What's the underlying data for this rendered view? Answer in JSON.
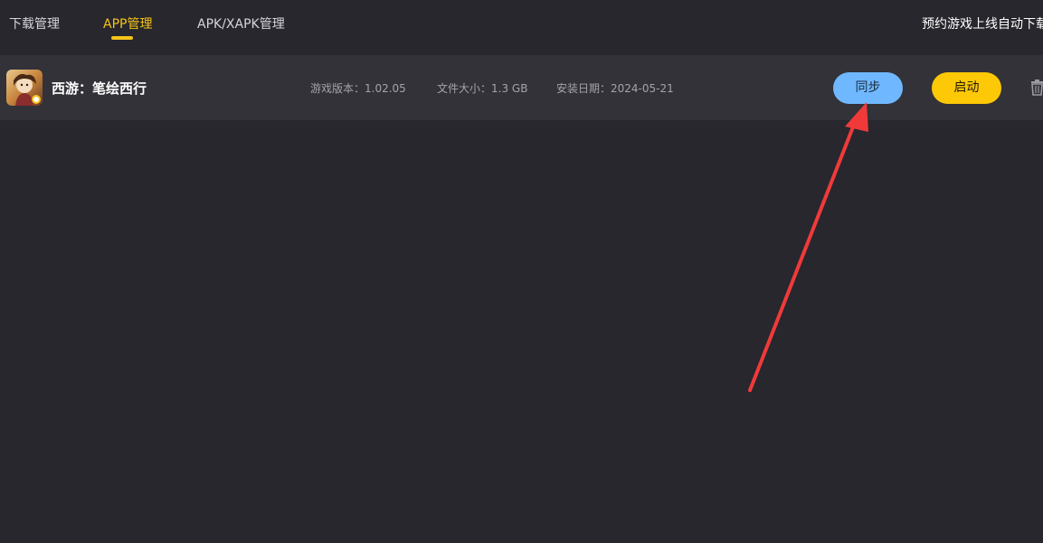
{
  "tabs": [
    {
      "label": "下载管理",
      "active": false
    },
    {
      "label": "APP管理",
      "active": true
    },
    {
      "label": "APK/XAPK管理",
      "active": false
    }
  ],
  "promo_text": "预约游戏上线自动下载",
  "app": {
    "name": "西游：笔绘西行",
    "version": "游戏版本：1.02.05",
    "size": "文件大小：1.3 GB",
    "install_date": "安装日期：2024-05-21",
    "sync_label": "同步",
    "launch_label": "启动",
    "icon": "game-thumbnail-icon"
  },
  "annotation": {
    "arrow_color": "#f03a3a",
    "target": "sync-button"
  },
  "colors": {
    "accent": "#f5c418",
    "sync_button": "#6fb8ff",
    "launch_button": "#fdc806",
    "background": "#27272d",
    "row_background": "#323238"
  }
}
